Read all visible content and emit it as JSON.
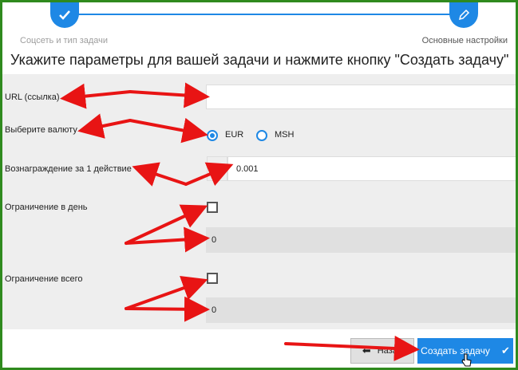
{
  "stepper": {
    "step1_label": "Соцсеть и тип задачи",
    "step2_label": "Основные настройки",
    "step1_icon": "check-icon",
    "step2_icon": "pencil-icon"
  },
  "heading": "Укажите параметры для вашей задачи и нажмите кнопку \"Создать задачу\"",
  "form": {
    "url_label": "URL (ссылка)",
    "url_value": "",
    "currency_label": "Выберите валюту",
    "currency_options": [
      "EUR",
      "MSH"
    ],
    "currency_selected": "EUR",
    "reward_label": "Вознаграждение за 1 действие",
    "reward_prefix": "€",
    "reward_value": "0.001",
    "daily_limit_label": "Ограничение в день",
    "daily_limit_value": "0",
    "total_limit_label": "Ограничение всего",
    "total_limit_value": "0"
  },
  "buttons": {
    "back_label": "Назад",
    "create_label": "Создать задачу"
  },
  "colors": {
    "accent": "#1e88e5",
    "annotation_arrow": "#e81414",
    "frame": "#2f8a1e"
  }
}
